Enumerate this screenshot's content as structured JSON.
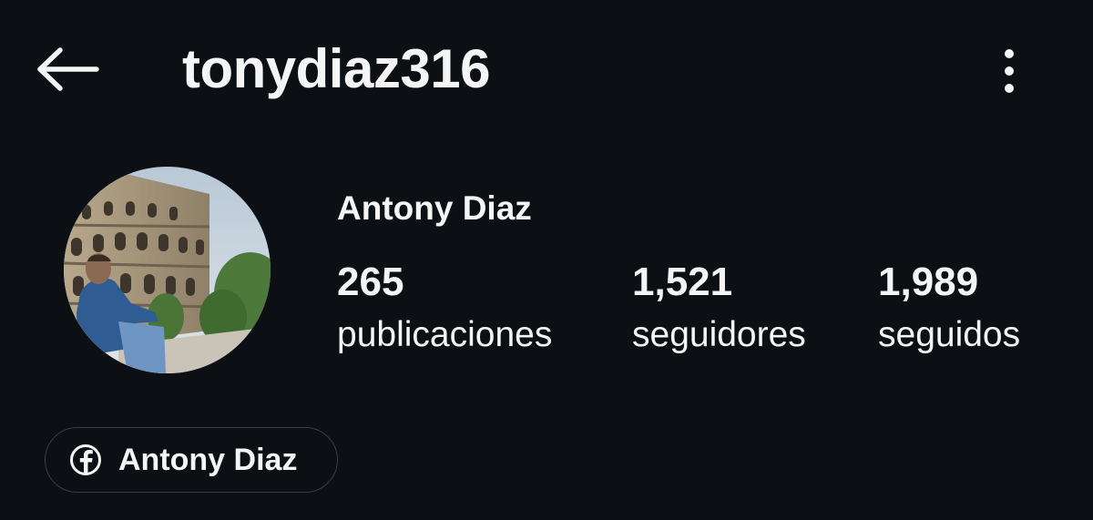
{
  "header": {
    "username": "tonydiaz316",
    "back_icon": "arrow-left-icon",
    "more_icon": "more-vertical-icon"
  },
  "profile": {
    "full_name": "Antony Diaz",
    "avatar_description_icon": "profile-photo",
    "stats": {
      "posts": {
        "count": "265",
        "label": "publicaciones"
      },
      "followers": {
        "count": "1,521",
        "label": "seguidores"
      },
      "following": {
        "count": "1,989",
        "label": "seguidos"
      }
    }
  },
  "link": {
    "icon": "facebook-icon",
    "label": "Antony Diaz"
  },
  "colors": {
    "background": "#0c1014",
    "text": "#f5f5f5",
    "chip_border": "#3a3d42"
  }
}
